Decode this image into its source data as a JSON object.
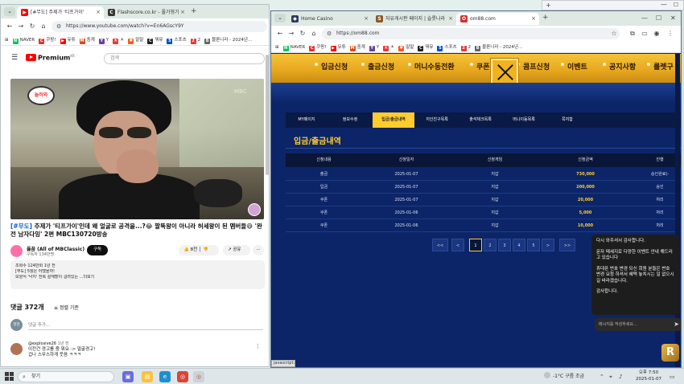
{
  "left_browser": {
    "tabs": [
      {
        "label": "[#무도] 주제가 '티프가이'"
      },
      {
        "label": "Flashscore.co.kr - 풀가형기"
      }
    ],
    "url": "https://www.youtube.com/watch?v=En6AGscY9Y",
    "bookmarks": [
      {
        "label": "NAVER",
        "color": "#03c75a",
        "icon": "N"
      },
      {
        "label": "쿠팡!",
        "color": "#e4342c",
        "icon": "C"
      },
      {
        "label": "유튜",
        "color": "#ff0000",
        "icon": "▶"
      },
      {
        "label": "중계",
        "color": "#d84b18",
        "icon": "M"
      },
      {
        "label": "Y",
        "color": "#6b3fa0",
        "icon": "Y"
      },
      {
        "label": "ㅊ",
        "color": "#e53935",
        "icon": "ㅊ"
      },
      {
        "label": "말말",
        "color": "#ff5722",
        "icon": "♥"
      },
      {
        "label": "꿔뮤",
        "color": "#222222",
        "icon": "C"
      },
      {
        "label": "스포츠",
        "color": "#0052cc",
        "icon": "S"
      },
      {
        "label": "2",
        "color": "#e53935",
        "icon": "2"
      },
      {
        "label": "블론니라 - 2024년...",
        "color": "#666666",
        "icon": "B"
      }
    ]
  },
  "youtube": {
    "brand": "Premium",
    "brand_sup": "KR",
    "search_placeholder": "검색",
    "video_badge": "놀러와",
    "video_caption": "MBC",
    "title_hashtag": "[#무도]",
    "title_rest": " 주제가 '티프가이'인데 왜 얼굴로 공격을...?😂 팔뚝왕이 아니라 허세왕이 된 멤버들😅 '완전 남자다잉' 2편 MBC130720방송",
    "channel_name": "옳꿉 (All of MBClassic)",
    "channel_subs": "구독자 134만명",
    "subscribe_label": "구독",
    "like_count": "8천",
    "share_label": "공유",
    "more_label": "···",
    "description_lines": [
      "조회수 124만회  1년 전",
      "[무도] 5월은 어땠을까!",
      "보양식 '낙지' 전복 살재할이 걸려있는 ...더보기"
    ],
    "comment_count": "댓글 372개",
    "sort_label": "정렬 기준",
    "me_avatar": "정현",
    "add_comment_placeholder": "댓글 추가...",
    "comment": {
      "user": "@explosive26",
      "time": "1년 전",
      "lines": [
        "이전건 경고를 줌 뭐요 -> 얼굴경고!",
        "겁나 스무스하게 웃음 ㅋㅋㅋ"
      ]
    }
  },
  "right_browser": {
    "tabs": [
      {
        "label": "Home Casino"
      },
      {
        "label": "자유게시판 페이지 | 슬롯나라"
      },
      {
        "label": "om88.com"
      }
    ],
    "url": "https://om88.com",
    "bookmarks": [
      {
        "label": "NAVER",
        "color": "#03c75a",
        "icon": "N"
      },
      {
        "label": "쿠팡!",
        "color": "#e4342c",
        "icon": "C"
      },
      {
        "label": "유튜",
        "color": "#ff0000",
        "icon": "▶"
      },
      {
        "label": "중계",
        "color": "#d84b18",
        "icon": "M"
      },
      {
        "label": "Y",
        "color": "#6b3fa0",
        "icon": "Y"
      },
      {
        "label": "ㅊ",
        "color": "#e53935",
        "icon": "ㅊ"
      },
      {
        "label": "말말",
        "color": "#ff5722",
        "icon": "♥"
      },
      {
        "label": "꿔뮤",
        "color": "#222222",
        "icon": "C"
      },
      {
        "label": "스포츠",
        "color": "#0052cc",
        "icon": "S"
      },
      {
        "label": "2",
        "color": "#e53935",
        "icon": "2"
      },
      {
        "label": "블론니라 - 2024년...",
        "color": "#666666",
        "icon": "B"
      }
    ]
  },
  "site": {
    "nav": [
      "입금신청",
      "출금신청",
      "머니수동전환",
      "쿠폰",
      "콤프신청",
      "이벤트",
      "공지사항",
      "룰렛구"
    ],
    "subtabs": [
      "MY페이지",
      "정보수정",
      "입금/출금내역",
      "지인친구목록",
      "출석체크목록",
      "머니이동목록",
      "쪽지함"
    ],
    "active_subtab": 2,
    "section_title": "입금/출금내역",
    "columns": [
      "신청내용",
      "신청일자",
      "신청게임",
      "신청금액",
      "진행"
    ],
    "rows": [
      {
        "type": "출금",
        "date": "2025-01-07",
        "game": "지갑",
        "amount": "730,000",
        "status": "승인완료(-"
      },
      {
        "type": "입금",
        "date": "2025-01-07",
        "game": "지갑",
        "amount": "200,000",
        "status": "승인"
      },
      {
        "type": "쿠폰",
        "date": "2025-01-07",
        "game": "지갑",
        "amount": "20,000",
        "status": "처리"
      },
      {
        "type": "쿠폰",
        "date": "2025-01-06",
        "game": "지갑",
        "amount": "5,000",
        "status": "처리"
      },
      {
        "type": "쿠폰",
        "date": "2025-01-06",
        "game": "지갑",
        "amount": "10,000",
        "status": "처리"
      }
    ],
    "pagination": [
      "<<",
      "<",
      "1",
      "2",
      "3",
      "4",
      "5",
      ">",
      ">>"
    ],
    "current_page": "1"
  },
  "chat": {
    "paragraphs": [
      "다시 와주셔서 감사합니다.",
      "문자 메세지로 다양한 이벤트 안내 해드리고 있습니다",
      "휴대폰 번호 변경 되신 회원 분들은 번호 변경 요청 하셔서 혜택 놓치시는 일 없으시길 바라겠습니다.",
      "감사합니다."
    ],
    "input_placeholder": "메시지를 작성하세요...",
    "logo_letter": "R"
  },
  "status_tip": "javascript:",
  "taskbar": {
    "search_label": "찾기",
    "weather": "-1°C  구름 조금",
    "time": "오후 7:50",
    "date": "2025-01-07"
  }
}
